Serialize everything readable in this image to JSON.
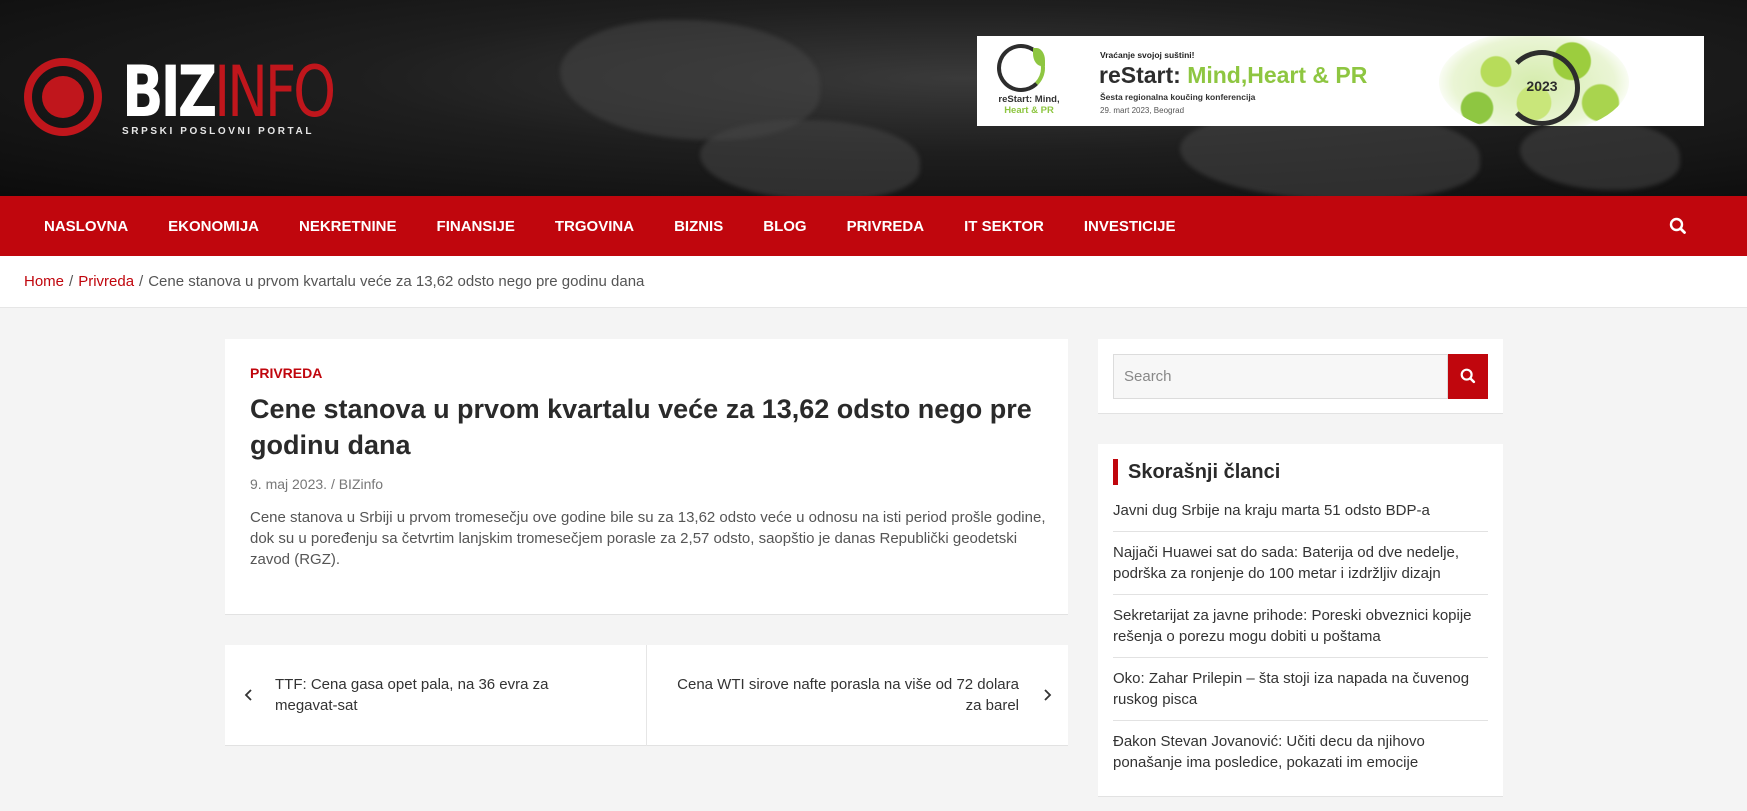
{
  "header": {
    "logo": {
      "word_biz": "BIZ",
      "word_info": "INFO",
      "tagline": "SRPSKI POSLOVNI PORTAL"
    },
    "banner": {
      "kicker": "Vraćanje svojoj suštini!",
      "title_prefix": "reStart:",
      "title_main": " Mind,Heart & PR",
      "subtitle": "Šesta regionalna koučing konferencija",
      "date": "29. mart 2023, Beograd",
      "brand_line1": "reStart: Mind,",
      "brand_line2": "Heart & PR",
      "year": "2023",
      "accent_color": "#8ec641"
    }
  },
  "nav": {
    "items": [
      {
        "label": "NASLOVNA"
      },
      {
        "label": "EKONOMIJA"
      },
      {
        "label": "NEKRETNINE"
      },
      {
        "label": "FINANSIJE"
      },
      {
        "label": "TRGOVINA"
      },
      {
        "label": "BIZNIS"
      },
      {
        "label": "BLOG"
      },
      {
        "label": "PRIVREDA"
      },
      {
        "label": "IT SEKTOR"
      },
      {
        "label": "INVESTICIJE"
      }
    ],
    "search_icon": "search-icon",
    "background_color": "#c0060d"
  },
  "breadcrumb": {
    "home": "Home",
    "category": "Privreda",
    "current": "Cene stanova u prvom kvartalu veće za 13,62 odsto nego pre godinu dana",
    "separator": "/"
  },
  "article": {
    "category": "PRIVREDA",
    "title": "Cene stanova u prvom kvartalu veće za 13,62 odsto nego pre godinu dana",
    "meta": "9. maj 2023. / BIZinfo",
    "excerpt": "Cene stanova u Srbiji u prvom tromesečju ove godine bile su za 13,62 odsto veće u odnosu na isti period prošle godine, dok su u poređenju sa četvrtim lanjskim tromesečjem porasle za 2,57 odsto, saopštio je danas Republički geodetski zavod (RGZ)."
  },
  "post_nav": {
    "previous": "TTF: Cena gasa opet pala, na 36 evra za megavat-sat",
    "next": "Cena WTI sirove nafte porasla na više od 72 dolara za barel"
  },
  "sidebar": {
    "search": {
      "placeholder": "Search"
    },
    "recent": {
      "heading": "Skorašnji članci",
      "items": [
        "Javni dug Srbije na kraju marta 51 odsto BDP-a",
        "Najjači Huawei sat do sada: Baterija od dve nedelje, podrška za ronjenje do 100 metar i izdržljiv dizajn",
        "Sekretarijat za javne prihode: Poreski obveznici kopije rešenja o porezu mogu dobiti u poštama",
        "Oko: Zahar Prilepin – šta stoji iza napada na čuvenog ruskog pisca",
        "Đakon Stevan Jovanović: Učiti decu da njihovo ponašanje ima posledice, pokazati im emocije"
      ]
    }
  }
}
